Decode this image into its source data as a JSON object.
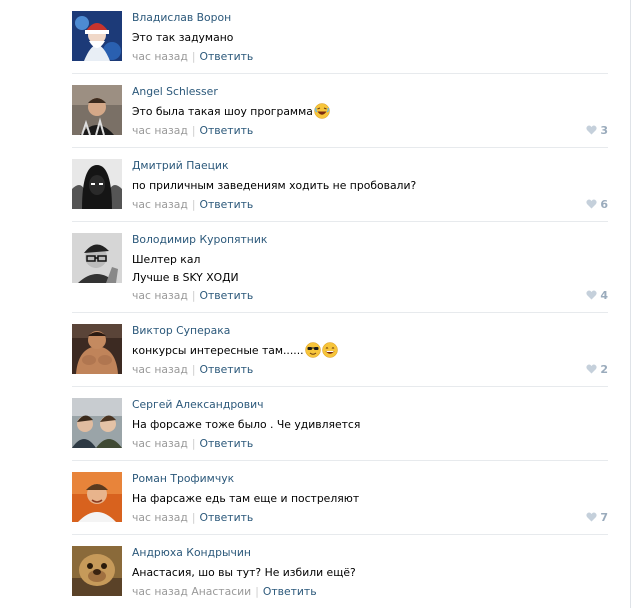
{
  "comments": [
    {
      "author": "Владислав Ворон",
      "lines": [
        "Это так задумано"
      ],
      "time": "час назад",
      "reply_to": "",
      "reply_label": "Ответить",
      "likes": ""
    },
    {
      "author": "Angel Schlesser",
      "lines": [
        "Это была такая шоу программа"
      ],
      "time": "час назад",
      "reply_to": "",
      "reply_label": "Ответить",
      "likes": "3"
    },
    {
      "author": "Дмитрий Паецик",
      "lines": [
        "по приличным заведениям ходить не пробовали?"
      ],
      "time": "час назад",
      "reply_to": "",
      "reply_label": "Ответить",
      "likes": "6"
    },
    {
      "author": "Володимир Куропятник",
      "lines": [
        "Шелтер кал",
        "Лучше в SKY ХОДИ"
      ],
      "time": "час назад",
      "reply_to": "",
      "reply_label": "Ответить",
      "likes": "4"
    },
    {
      "author": "Виктор Суперака",
      "lines": [
        "конкурсы интересные там......"
      ],
      "time": "час назад",
      "reply_to": "",
      "reply_label": "Ответить",
      "likes": "2"
    },
    {
      "author": "Сергей Александрович",
      "lines": [
        "На форсаже тоже было . Че удивляется"
      ],
      "time": "час назад",
      "reply_to": "",
      "reply_label": "Ответить",
      "likes": ""
    },
    {
      "author": "Роман Трофимчук",
      "lines": [
        "На фарсаже едь там еще и постреляют"
      ],
      "time": "час назад",
      "reply_to": "",
      "reply_label": "Ответить",
      "likes": "7"
    },
    {
      "author": "Андрюха Кондрычин",
      "lines": [
        "Анастасия, шо вы тут? Не избили ещё?"
      ],
      "time": "час назад",
      "reply_to": "Анастасии",
      "reply_label": "Ответить",
      "likes": ""
    }
  ],
  "emoji": {
    "laughing": "laughing-face-emoji",
    "sunglasses": "sunglasses-face-emoji",
    "grin": "grinning-face-emoji"
  },
  "colors": {
    "link": "#2b587a",
    "meta": "#999999",
    "like": "#9aabbc",
    "separator": "#e7eaed"
  }
}
